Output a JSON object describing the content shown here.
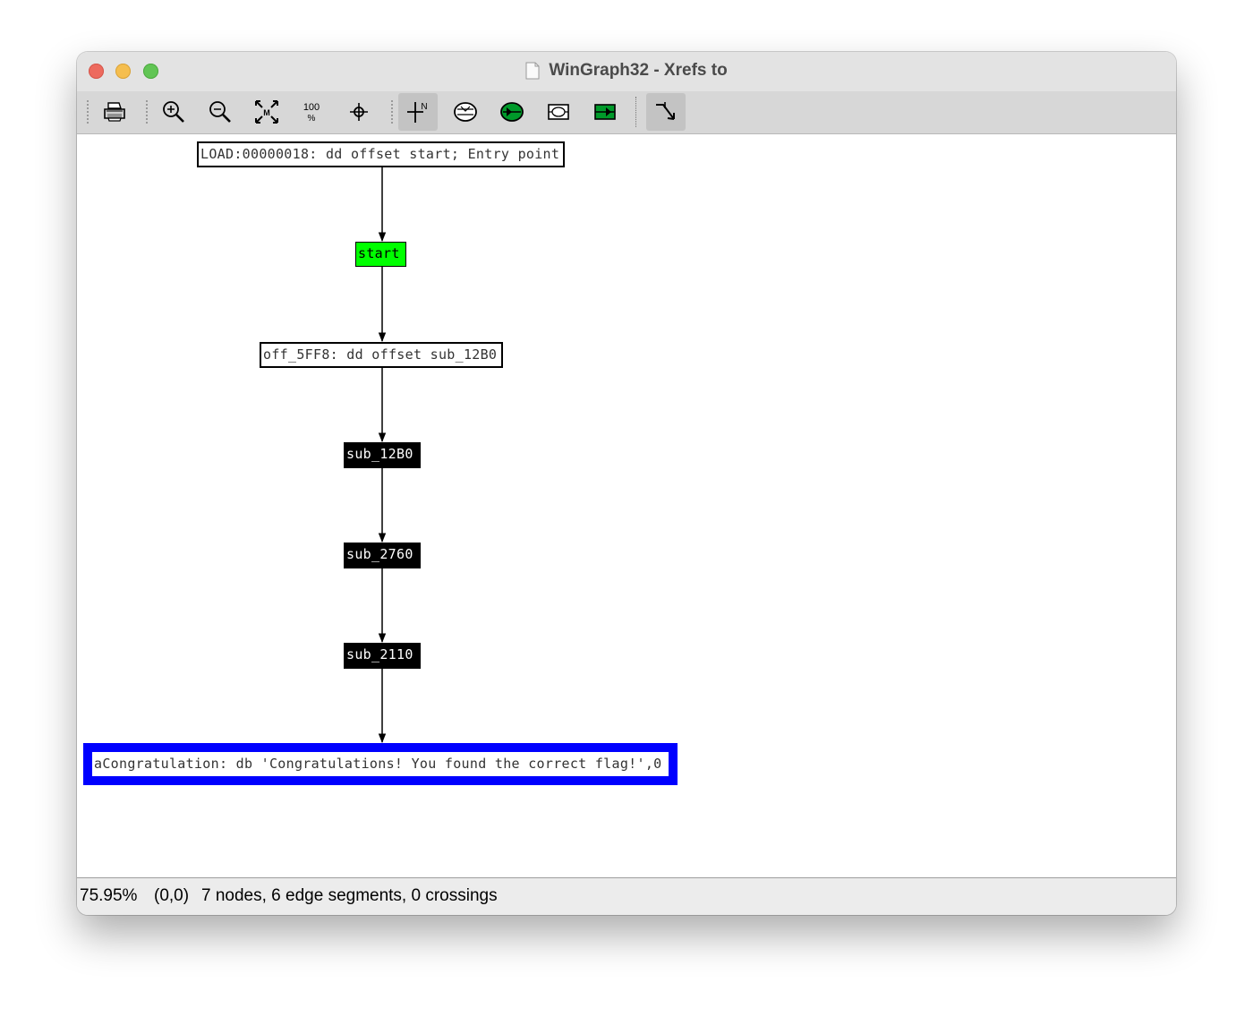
{
  "window": {
    "title": "WinGraph32 - Xrefs to"
  },
  "toolbar": {
    "buttons": [
      {
        "name": "print",
        "icon": "printer-icon"
      },
      {
        "name": "zoom-in",
        "icon": "zoom-in-icon"
      },
      {
        "name": "zoom-out",
        "icon": "zoom-out-icon"
      },
      {
        "name": "fit-window",
        "icon": "fit-window-icon"
      },
      {
        "name": "zoom-100",
        "icon": "zoom-100-icon",
        "label": "100"
      },
      {
        "name": "center",
        "icon": "crosshair-icon"
      },
      {
        "name": "north-orientation",
        "icon": "north-icon",
        "label": "N",
        "active": true
      },
      {
        "name": "layout-1",
        "icon": "layout-icon"
      },
      {
        "name": "layout-2",
        "icon": "layout-green-icon"
      },
      {
        "name": "layout-3",
        "icon": "layout-alt-icon"
      },
      {
        "name": "layout-4",
        "icon": "layout-green-alt-icon"
      },
      {
        "name": "follow-edge",
        "icon": "follow-edge-icon",
        "active": true
      }
    ]
  },
  "graph": {
    "nodes": [
      {
        "id": "load",
        "label": "LOAD:00000018: dd offset start; Entry point",
        "style": "white"
      },
      {
        "id": "start",
        "label": "start",
        "style": "green"
      },
      {
        "id": "off",
        "label": "off_5FF8: dd offset sub_12B0",
        "style": "white"
      },
      {
        "id": "sub12b0",
        "label": "sub_12B0",
        "style": "black"
      },
      {
        "id": "sub2760",
        "label": "sub_2760",
        "style": "black"
      },
      {
        "id": "sub2110",
        "label": "sub_2110",
        "style": "black"
      },
      {
        "id": "congrats",
        "label": "aCongratulation: db 'Congratulations! You found the correct flag!',0",
        "style": "blue"
      }
    ],
    "edges": [
      [
        "load",
        "start"
      ],
      [
        "start",
        "off"
      ],
      [
        "off",
        "sub12b0"
      ],
      [
        "sub12b0",
        "sub2760"
      ],
      [
        "sub2760",
        "sub2110"
      ],
      [
        "sub2110",
        "congrats"
      ]
    ],
    "colors": {
      "green": "#00ff00",
      "black": "#000000",
      "blue": "#0000ff"
    }
  },
  "status": {
    "zoom": "75.95%",
    "coords": "(0,0)",
    "summary": "7 nodes, 6 edge segments, 0 crossings"
  }
}
